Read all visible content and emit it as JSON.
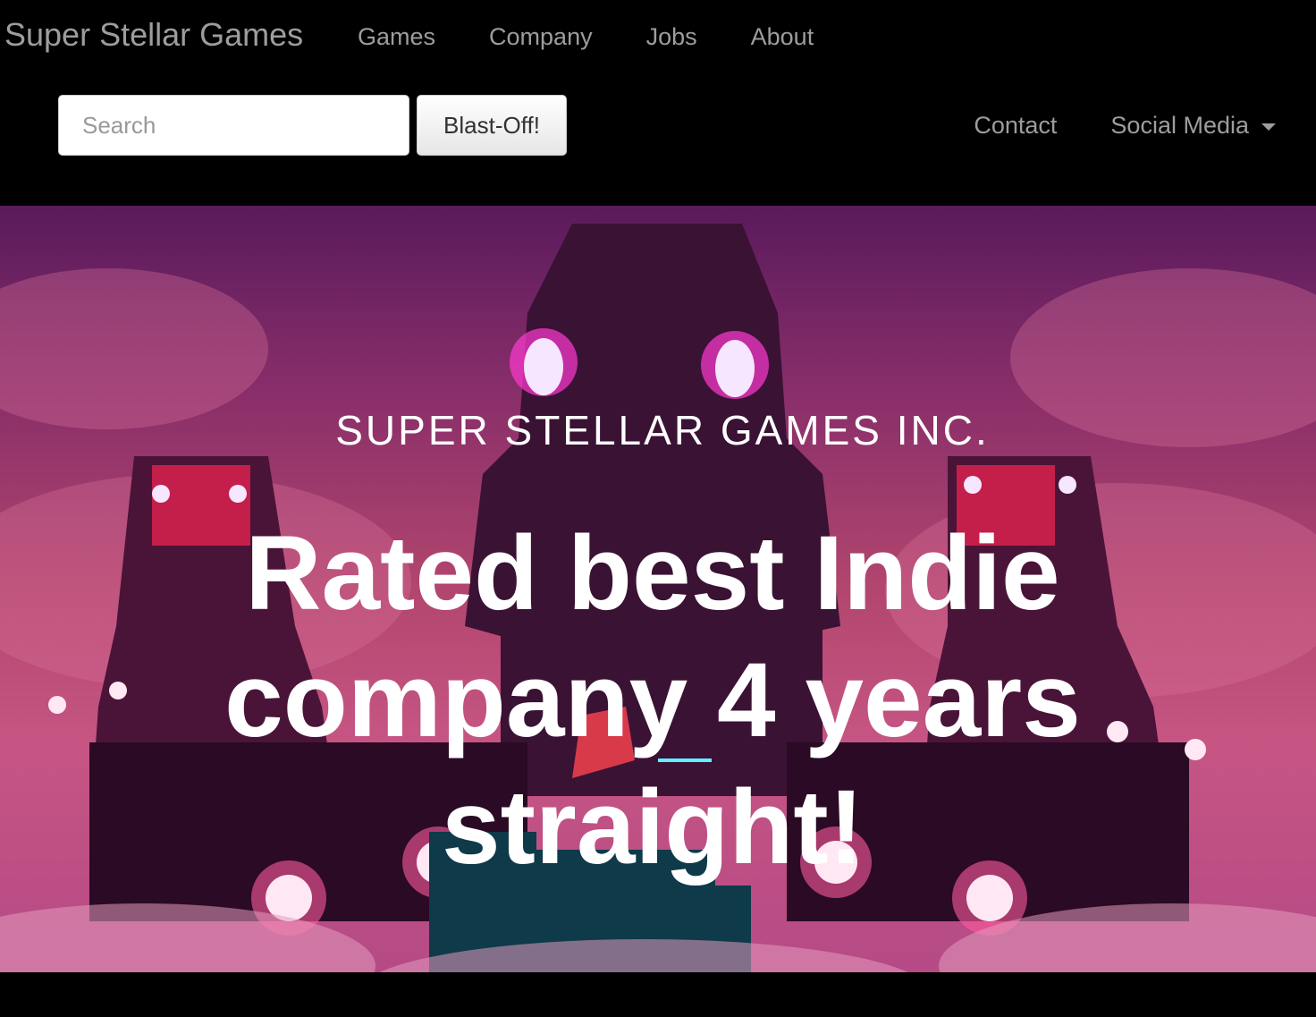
{
  "navbar": {
    "brand": "Super Stellar Games",
    "links": [
      "Games",
      "Company",
      "Jobs",
      "About"
    ],
    "search": {
      "placeholder": "Search",
      "button_label": "Blast-Off!"
    },
    "right_links": {
      "contact": "Contact",
      "social_media": "Social Media"
    }
  },
  "hero": {
    "subtitle": "SUPER STELLAR GAMES INC.",
    "title": "Rated best Indie company 4 years straight!"
  },
  "colors": {
    "navbar_bg": "#000000",
    "nav_text": "#9d9d9d",
    "hero_text": "#ffffff",
    "hero_bg_top": "#5a1a5c",
    "hero_bg_bottom": "#c65583"
  },
  "icons": {
    "social_media_dropdown": "caret-down-icon"
  }
}
